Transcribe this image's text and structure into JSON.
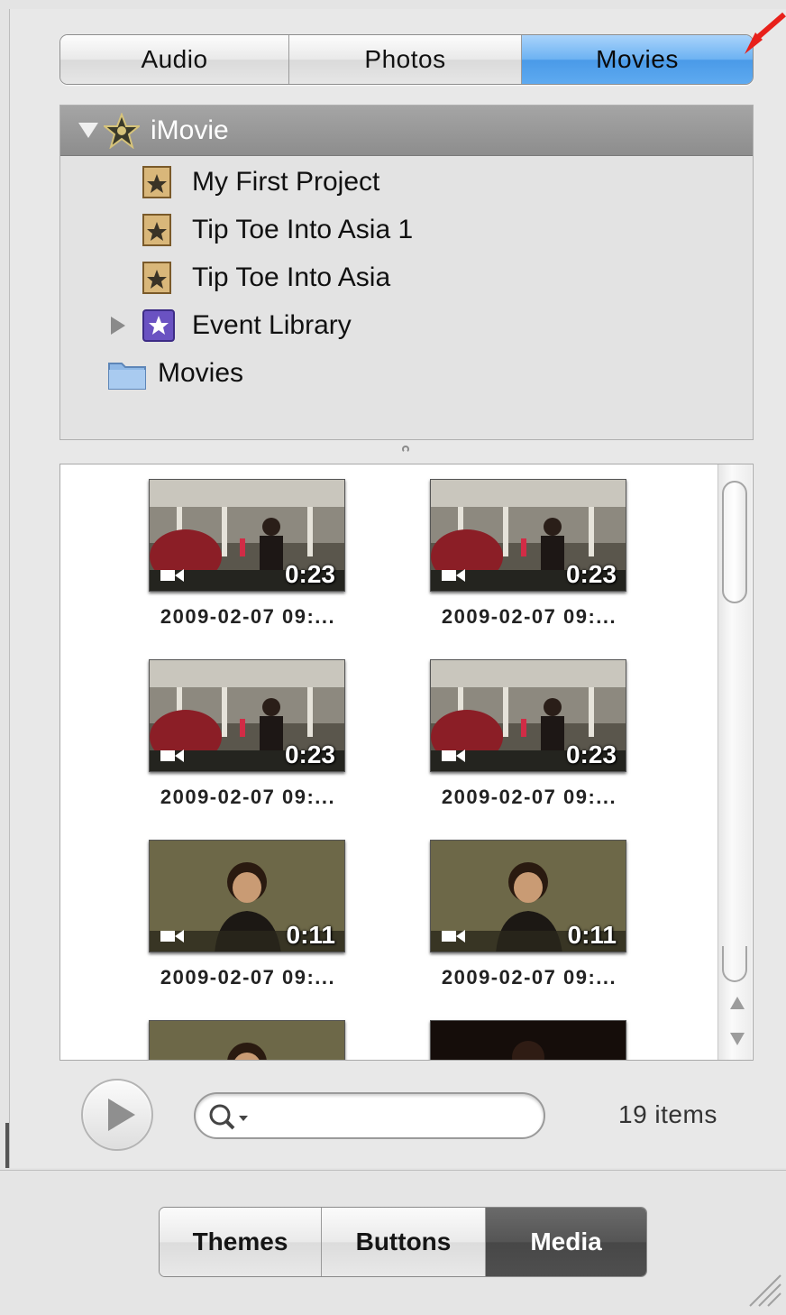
{
  "top_tabs": [
    "Audio",
    "Photos",
    "Movies"
  ],
  "top_tabs_active": "Movies",
  "tree": {
    "header": "iMovie",
    "items": [
      {
        "label": "My First Project",
        "icon": "project-icon"
      },
      {
        "label": "Tip Toe Into Asia 1",
        "icon": "project-icon"
      },
      {
        "label": "Tip Toe Into Asia",
        "icon": "project-icon"
      },
      {
        "label": "Event Library",
        "icon": "event-library-icon"
      },
      {
        "label": "Movies",
        "icon": "folder-icon"
      }
    ]
  },
  "clips": [
    {
      "duration": "0:23",
      "caption": "2009-02-07 09:..."
    },
    {
      "duration": "0:23",
      "caption": "2009-02-07 09:..."
    },
    {
      "duration": "0:23",
      "caption": "2009-02-07 09:..."
    },
    {
      "duration": "0:23",
      "caption": "2009-02-07 09:..."
    },
    {
      "duration": "0:11",
      "caption": "2009-02-07 09:..."
    },
    {
      "duration": "0:11",
      "caption": "2009-02-07 09:..."
    }
  ],
  "search": {
    "placeholder": "",
    "value": ""
  },
  "item_count": "19 items",
  "bottom_tabs": [
    "Themes",
    "Buttons",
    "Media"
  ],
  "bottom_tabs_active": "Media",
  "colors": {
    "accent": "#5eaaf0",
    "annotation_arrow": "#e8201a",
    "active_bottom_tab": "#4f4f4f"
  }
}
